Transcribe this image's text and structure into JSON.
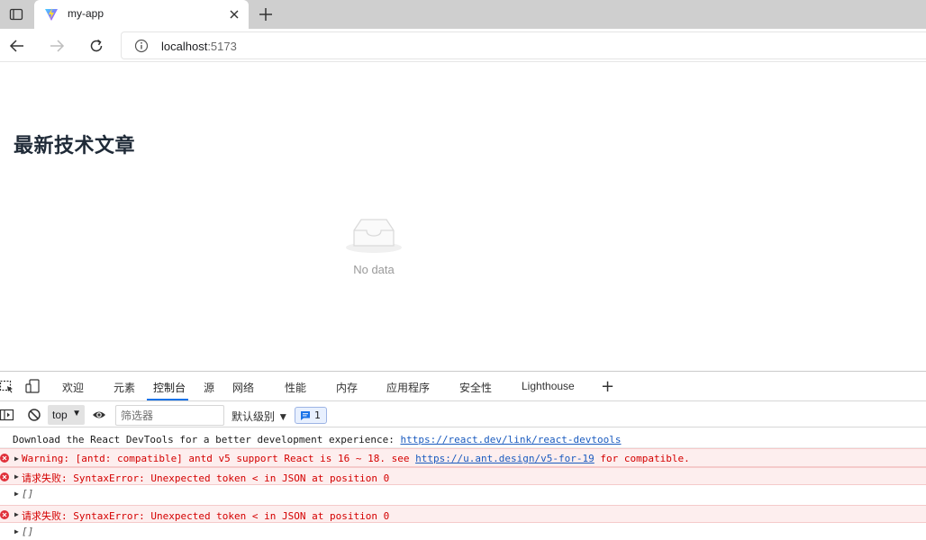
{
  "browser": {
    "tab_title": "my-app",
    "url_host": "localhost",
    "url_port": ":5173"
  },
  "page": {
    "heading": "最新技术文章",
    "empty_text": "No data"
  },
  "devtools": {
    "tabs": [
      "欢迎",
      "元素",
      "控制台",
      "源",
      "网络",
      "性能",
      "内存",
      "应用程序",
      "安全性",
      "Lighthouse"
    ],
    "active_tab": "控制台",
    "context": "top",
    "filter_placeholder": "筛选器",
    "level": "默认级别 ▼",
    "issues_count": "1",
    "messages": {
      "m1": {
        "text": "Download the React DevTools for a better development experience: ",
        "link": "https://react.dev/link/react-devtools"
      },
      "m2": {
        "text": "Warning: [antd: compatible] antd v5 support React is 16 ~ 18. see ",
        "link": "https://u.ant.design/v5-for-19",
        "tail": " for compatible."
      },
      "m3": {
        "text": "请求失败:  SyntaxError: Unexpected token < in JSON at position 0"
      },
      "m4": {
        "text": "[]"
      },
      "m5": {
        "text": "请求失败:  SyntaxError: Unexpected token < in JSON at position 0"
      },
      "m6": {
        "text": "[]"
      }
    }
  },
  "colors": {
    "error_bg": "#fdeeee",
    "error_text": "#d40000",
    "link": "#1a5bbf",
    "active_tab_underline": "#1a73e8"
  }
}
